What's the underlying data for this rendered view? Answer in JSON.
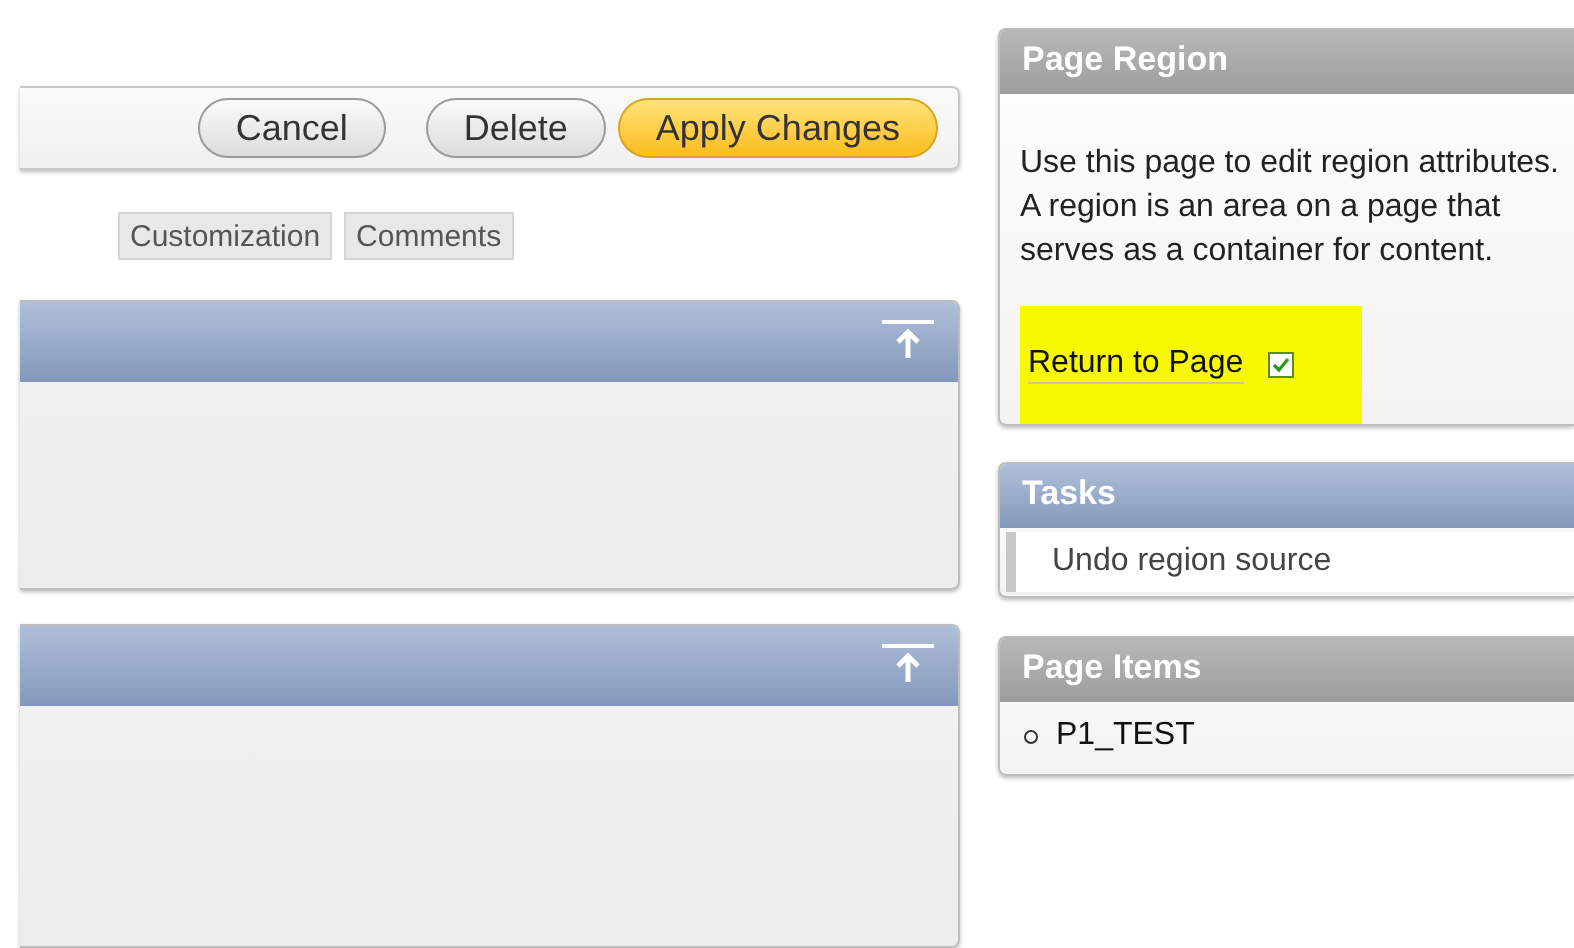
{
  "buttons": [
    {
      "label": "Cancel",
      "kind": "plain"
    },
    {
      "label": "Delete",
      "kind": "plain"
    },
    {
      "label": "Apply Changes",
      "kind": "primary"
    }
  ],
  "tabs": [
    {
      "label": "Customization"
    },
    {
      "label": "Comments"
    }
  ],
  "page_region": {
    "title": "Page Region",
    "text": "Use this page to edit region attributes. A region is an area on a page that serves as a container for content.",
    "return_link": "Return to Page",
    "return_checked": true
  },
  "tasks": {
    "title": "Tasks",
    "items": [
      "Undo region source"
    ]
  },
  "page_items": {
    "title": "Page Items",
    "items": [
      "P1_TEST"
    ]
  }
}
